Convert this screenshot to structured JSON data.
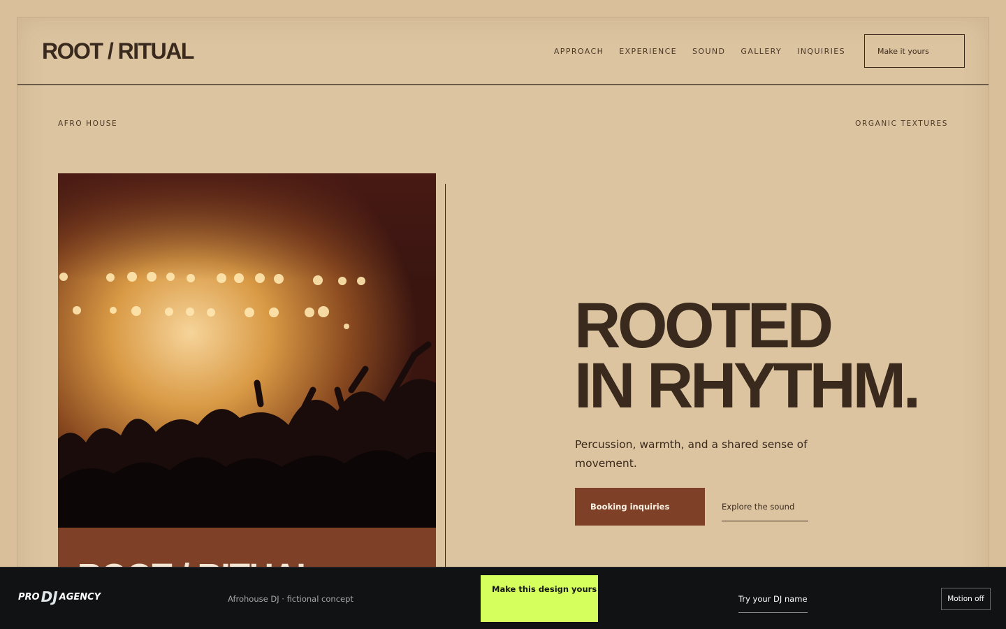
{
  "header": {
    "brand": "ROOT / RITUAL",
    "nav": [
      "APPROACH",
      "EXPERIENCE",
      "SOUND",
      "GALLERY",
      "INQUIRIES"
    ],
    "cta": "Make it yours"
  },
  "tags": {
    "left": "AFRO HOUSE",
    "right": "ORGANIC TEXTURES"
  },
  "hero": {
    "caption": "ROOT / RITUAL",
    "headline_line1": "ROOTED",
    "headline_line2": "IN RHYTHM.",
    "subtitle": "Percussion, warmth, and a shared sense of movement.",
    "primary_button": "Booking inquiries",
    "secondary_link": "Explore the sound"
  },
  "footer": {
    "logo_pro": "PRO",
    "logo_dj": "DJ",
    "logo_agency": "AGENCY",
    "concept": "Afrohouse DJ · fictional concept",
    "lime_button": "Make this design yours",
    "try_name": "Try your DJ name",
    "motion_toggle": "Motion off"
  },
  "colors": {
    "background": "#d9bf9a",
    "text": "#3a2a1e",
    "accent_brown": "#7e4128",
    "footer_bg": "#111214",
    "lime": "#d5ff5c"
  }
}
